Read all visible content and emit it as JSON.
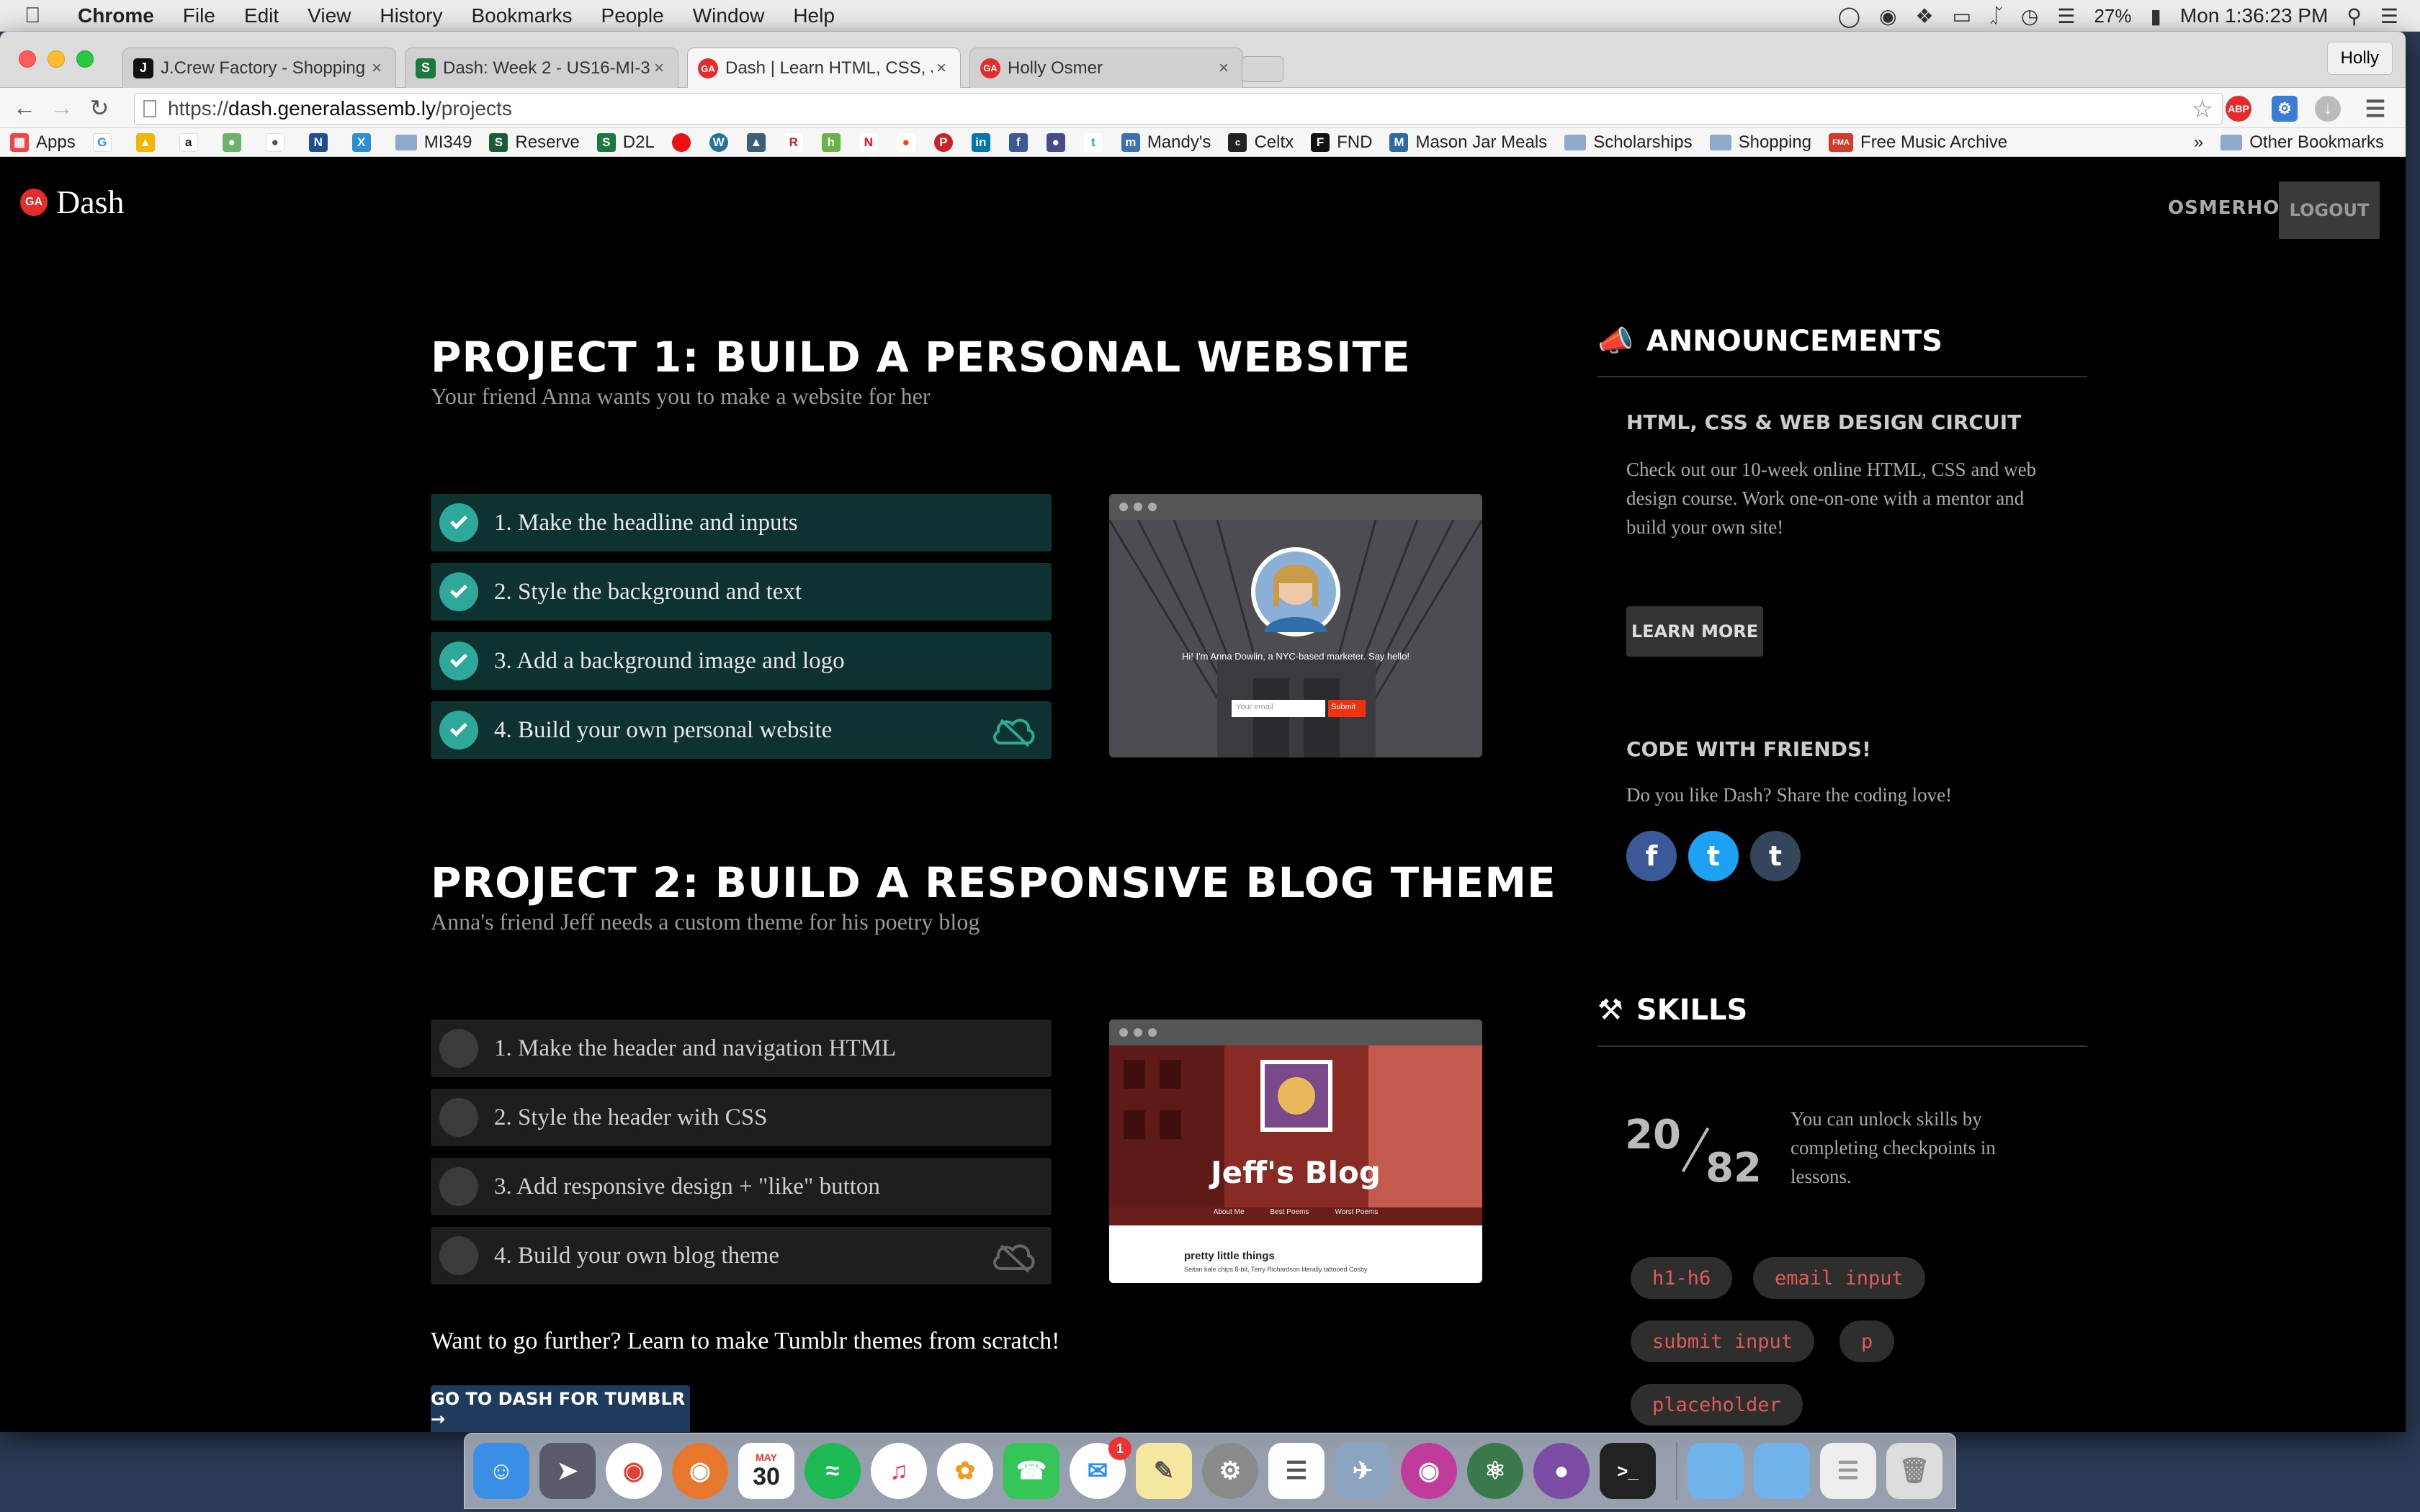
{
  "menubar": {
    "app": "Chrome",
    "items": [
      "File",
      "Edit",
      "View",
      "History",
      "Bookmarks",
      "People",
      "Window",
      "Help"
    ],
    "battery": "27%",
    "clock": "Mon 1:36:23 PM"
  },
  "tabs": [
    {
      "title": "J.Crew Factory - Shopping",
      "icon": "J",
      "color": "#111111"
    },
    {
      "title": "Dash: Week 2 - US16-MI-3",
      "icon": "S",
      "color": "#1a7a3e"
    },
    {
      "title": "Dash | Learn HTML, CSS, J",
      "icon": "GA",
      "color": "#e42c2c"
    },
    {
      "title": "Holly Osmer",
      "icon": "GA",
      "color": "#e42c2c"
    }
  ],
  "profile": "Holly",
  "address": {
    "prefix": "https://",
    "domain": "dash.generalassemb.ly",
    "path": "/projects"
  },
  "bookmarks": {
    "apps": "Apps",
    "items": [
      {
        "label": "MI349",
        "folder": true
      },
      {
        "label": "Reserve",
        "icon": "S",
        "color": "#1a5c3a"
      },
      {
        "label": "D2L",
        "icon": "S",
        "color": "#1a7a3e"
      },
      {
        "label": "Mandy's",
        "icon": "m",
        "color": "#3b6fb6"
      },
      {
        "label": "Celtx",
        "icon": "c",
        "color": "#222222"
      },
      {
        "label": "FND",
        "icon": "F",
        "color": "#111111"
      },
      {
        "label": "Mason Jar Meals",
        "icon": "M",
        "color": "#2a6aa5"
      },
      {
        "label": "Scholarships",
        "folder": true
      },
      {
        "label": "Shopping",
        "folder": true
      },
      {
        "label": "Free Music Archive",
        "icon": "FMA",
        "color": "#d43a2a"
      }
    ],
    "other": "Other Bookmarks"
  },
  "header": {
    "brand": "Dash",
    "username": "OSMERHOL",
    "logout": "LOGOUT"
  },
  "project1": {
    "title": "PROJECT 1: BUILD A PERSONAL WEBSITE",
    "subtitle": "Your friend Anna wants you to make a website for her",
    "steps": [
      "1. Make the headline and inputs",
      "2. Style the background and text",
      "3. Add a background image and logo",
      "4. Build your own personal website"
    ],
    "preview": {
      "tagline": "Hi! I'm Anna Dowlin, a NYC-based marketer. Say hello!",
      "input": "Your email",
      "submit": "Submit"
    }
  },
  "project2": {
    "title": "PROJECT 2: BUILD A RESPONSIVE BLOG THEME",
    "subtitle": "Anna's friend Jeff needs a custom theme for his poetry blog",
    "steps": [
      "1. Make the header and navigation HTML",
      "2. Style the header with CSS",
      "3. Add responsive design + \"like\" button",
      "4. Build your own blog theme"
    ],
    "preview": {
      "blog": "Jeff's Blog",
      "nav": [
        "About Me",
        "Best Poems",
        "Worst Poems"
      ],
      "post": "pretty little things",
      "post_text": "Seitan kale chips 8-bit, Terry Richardson literally tattooed Cosby"
    }
  },
  "tumblr": {
    "text": "Want to go further? Learn to make Tumblr themes from scratch!",
    "button": "GO TO DASH FOR TUMBLR →"
  },
  "announcements": {
    "heading": "ANNOUNCEMENTS",
    "sub": "HTML, CSS & WEB DESIGN CIRCUIT",
    "body": "Check out our 10-week online HTML, CSS and web design course. Work one-on-one with a mentor and build your own site!",
    "button": "LEARN MORE",
    "friends_heading": "CODE WITH FRIENDS!",
    "friends_body": "Do you like Dash? Share the coding love!",
    "social": [
      "f",
      "t",
      "t"
    ]
  },
  "skills": {
    "heading": "SKILLS",
    "unlocked": "20",
    "total": "82",
    "note": "You can unlock skills by completing checkpoints in lessons.",
    "tags": [
      "h1-h6",
      "email input",
      "submit input",
      "p",
      "placeholder"
    ]
  },
  "dock": {
    "calendar_month": "MAY",
    "calendar_day": "30",
    "messages_badge": "1"
  }
}
